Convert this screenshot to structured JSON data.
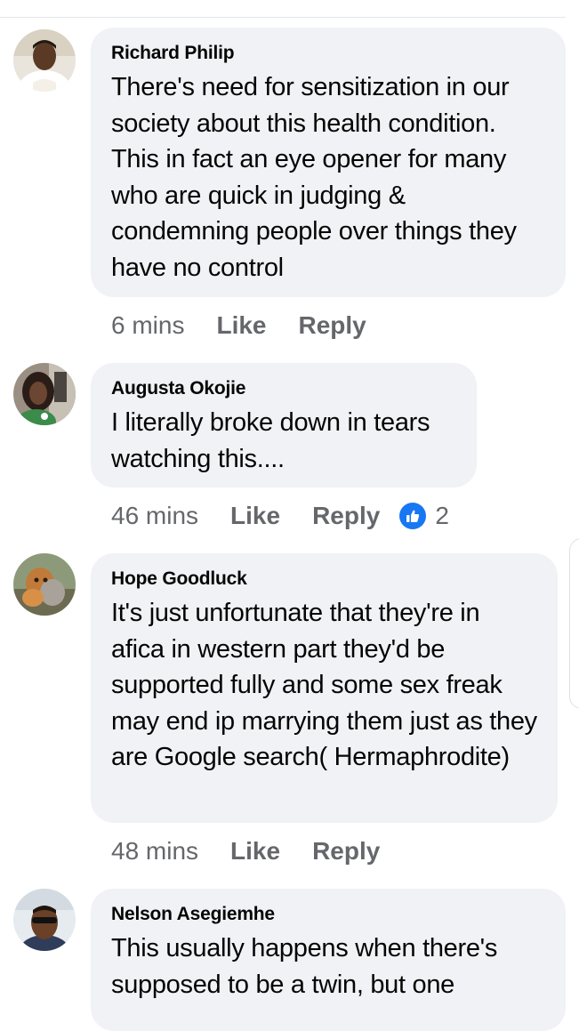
{
  "comments": [
    {
      "author": "Richard Philip",
      "text": "There's need for sensitization in our society about this health condition. This in fact an eye opener for many who are quick in judging & condemning people over things they have no control",
      "time": "6 mins",
      "like_label": "Like",
      "reply_label": "Reply",
      "avatar_icon": "avatar-photo"
    },
    {
      "author": "Augusta Okojie",
      "text": "I literally broke down in tears watching this....",
      "time": "46 mins",
      "like_label": "Like",
      "reply_label": "Reply",
      "reaction_icon": "thumbs-up-icon",
      "reaction_count": "2",
      "avatar_icon": "avatar-photo"
    },
    {
      "author": "Hope Goodluck",
      "text": "It's just unfortunate that they're in afica in western part they'd be supported fully and some sex freak may end ip marrying them just as they are Google search( Hermaphrodite)",
      "time": "48 mins",
      "like_label": "Like",
      "reply_label": "Reply",
      "avatar_icon": "avatar-photo"
    },
    {
      "author": "Nelson Asegiemhe",
      "text": "This usually happens when there's supposed to be a twin, but one",
      "avatar_icon": "avatar-photo"
    }
  ],
  "colors": {
    "bubble_bg": "#f0f2f5",
    "meta_text": "#65676b",
    "like_blue": "#1877f2"
  }
}
